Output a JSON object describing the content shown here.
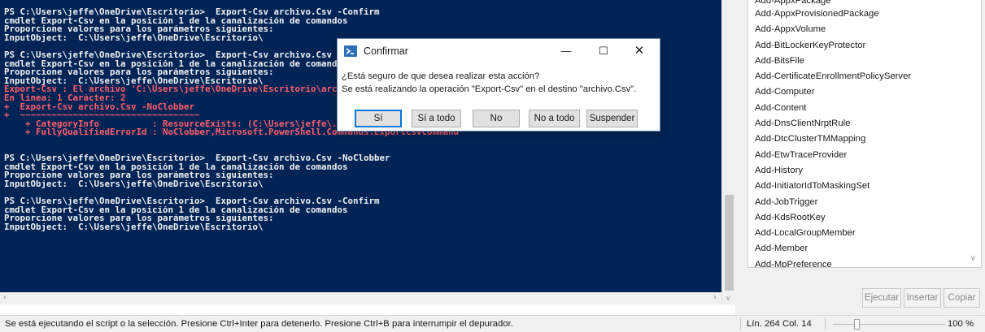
{
  "console": {
    "lines": [
      {
        "text": "PS C:\\Users\\jeffe\\OneDrive\\Escritorio>  Export-Csv archivo.Csv -Confirm",
        "kind": "normal"
      },
      {
        "text": "cmdlet Export-Csv en la posición 1 de la canalización de comandos",
        "kind": "normal"
      },
      {
        "text": "Proporcione valores para los parámetros siguientes:",
        "kind": "normal"
      },
      {
        "text": "InputObject:  C:\\Users\\jeffe\\OneDrive\\Escritorio\\",
        "kind": "normal"
      },
      {
        "text": "",
        "kind": "gap"
      },
      {
        "text": "PS C:\\Users\\jeffe\\OneDrive\\Escritorio>  Export-Csv archivo.Csv -NoClobber",
        "kind": "normal"
      },
      {
        "text": "cmdlet Export-Csv en la posición 1 de la canalización de comandos",
        "kind": "normal"
      },
      {
        "text": "Proporcione valores para los parámetros siguientes:",
        "kind": "normal"
      },
      {
        "text": "InputObject:  C:\\Users\\jeffe\\OneDrive\\Escritorio\\",
        "kind": "normal"
      },
      {
        "text": "Export-Csv : El archivo 'C:\\Users\\jeffe\\OneDrive\\Escritorio\\archivo.Csv' ya existe.",
        "kind": "err"
      },
      {
        "text": "En línea: 1 Carácter: 2",
        "kind": "err"
      },
      {
        "text": "+  Export-Csv archivo.Csv -NoClobber",
        "kind": "err"
      },
      {
        "text": "+  ~~~~~~~~~~~~~~~~~~~~~~~~~~~~~~~~~~",
        "kind": "err"
      },
      {
        "text": "    + CategoryInfo          : ResourceExists: (C:\\Users\\jeffe\\...rio\\archivo.Csv:String) [Export-Csv], IOException",
        "kind": "err"
      },
      {
        "text": "    + FullyQualifiedErrorId : NoClobber,Microsoft.PowerShell.Commands.ExportCsvCommand",
        "kind": "err"
      },
      {
        "text": "",
        "kind": "gap"
      },
      {
        "text": "",
        "kind": "gap"
      },
      {
        "text": "PS C:\\Users\\jeffe\\OneDrive\\Escritorio>  Export-Csv archivo.Csv -NoClobber",
        "kind": "normal"
      },
      {
        "text": "cmdlet Export-Csv en la posición 1 de la canalización de comandos",
        "kind": "normal"
      },
      {
        "text": "Proporcione valores para los parámetros siguientes:",
        "kind": "normal"
      },
      {
        "text": "InputObject:  C:\\Users\\jeffe\\OneDrive\\Escritorio\\",
        "kind": "normal"
      },
      {
        "text": "",
        "kind": "gap"
      },
      {
        "text": "PS C:\\Users\\jeffe\\OneDrive\\Escritorio>  Export-Csv archivo.Csv -Confirm",
        "kind": "normal"
      },
      {
        "text": "cmdlet Export-Csv en la posición 1 de la canalización de comandos",
        "kind": "normal"
      },
      {
        "text": "Proporcione valores para los parámetros siguientes:",
        "kind": "normal"
      },
      {
        "text": "InputObject:  C:\\Users\\jeffe\\OneDrive\\Escritorio\\",
        "kind": "normal"
      }
    ],
    "colors": {
      "background": "#012456",
      "text": "#f2f2f2",
      "error": "#ff5f6b"
    }
  },
  "dialog": {
    "title": "Confirmar",
    "question": "¿Está seguro de que desea realizar esta acción?",
    "detail": "Se está realizando la operación \"Export-Csv\" en el destino \"archivo.Csv\".",
    "buttons": {
      "si": "Sí",
      "si_a_todo": "Sí a todo",
      "no": "No",
      "no_a_todo": "No a todo",
      "suspender": "Suspender"
    },
    "icon": "powershell-icon"
  },
  "commands": {
    "items": [
      "Add-AppxProvisionedPackage",
      "Add-AppxVolume",
      "Add-BitLockerKeyProtector",
      "Add-BitsFile",
      "Add-CertificateEnrollmentPolicyServer",
      "Add-Computer",
      "Add-Content",
      "Add-DnsClientNrptRule",
      "Add-DtcClusterTMMapping",
      "Add-EtwTraceProvider",
      "Add-History",
      "Add-InitiatorIdToMaskingSet",
      "Add-JobTrigger",
      "Add-KdsRootKey",
      "Add-LocalGroupMember",
      "Add-Member",
      "Add-MpPreference"
    ],
    "partial_top_item": "Add-AppxPackage",
    "buttons": {
      "ejecutar": "Ejecutar",
      "insertar": "Insertar",
      "copiar": "Copiar"
    }
  },
  "status": {
    "message": "Se está ejecutando el script o la selección. Presione Ctrl+Inter para detenerlo. Presione Ctrl+B para interrumpir el depurador.",
    "position": "Lín. 264  Col. 14",
    "zoom": "100 %"
  }
}
